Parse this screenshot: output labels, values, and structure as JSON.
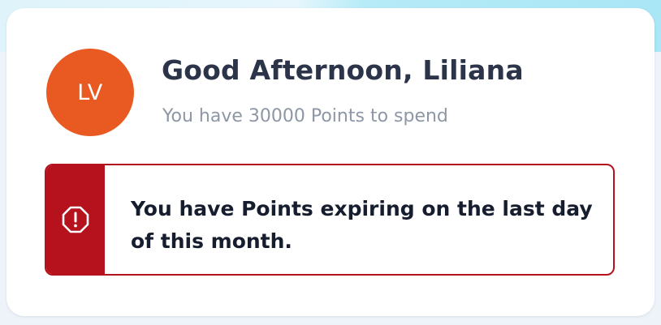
{
  "user": {
    "initials": "LV",
    "greeting": "Good Afternoon, Liliana",
    "points_message": "You have 30000 Points to spend"
  },
  "alert": {
    "icon": "alert-octagon-icon",
    "message": "You have Points expiring on the last day of this month."
  },
  "colors": {
    "avatar": "#e85a21",
    "alert_accent": "#b5121d",
    "heading_text": "#2b3449",
    "muted_text": "#8d97a5"
  }
}
